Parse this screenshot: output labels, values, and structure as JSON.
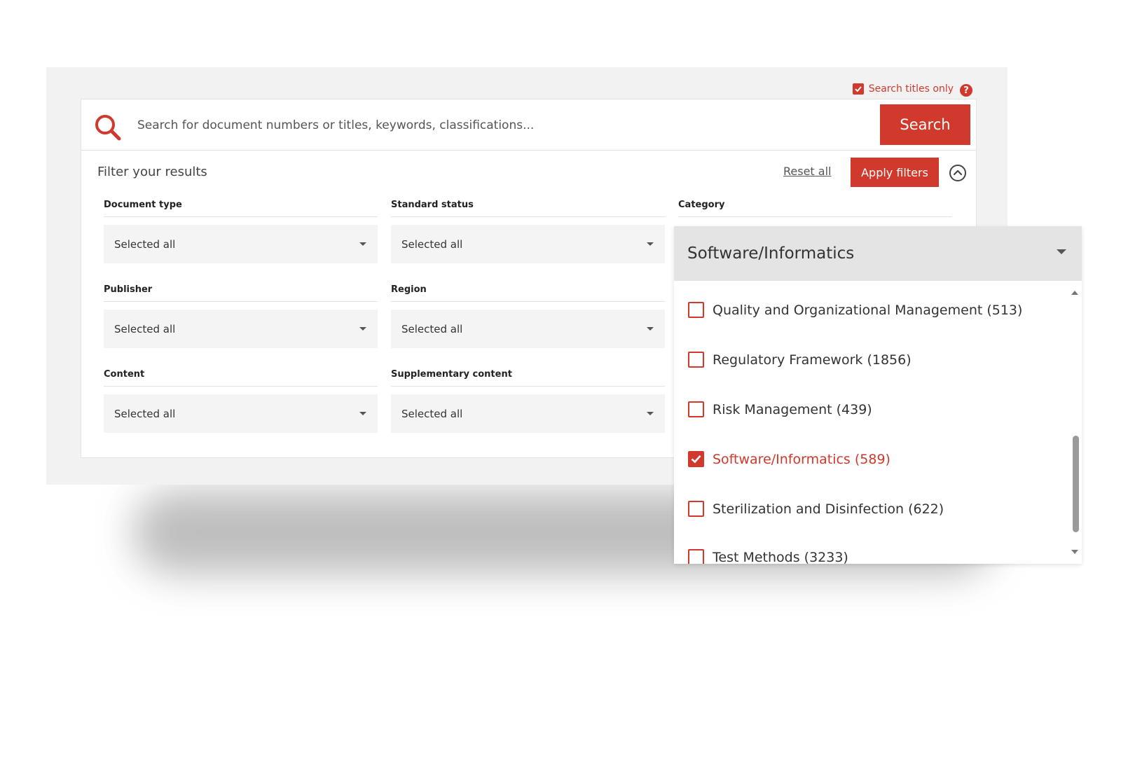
{
  "search": {
    "titles_only_label": "Search titles only",
    "titles_only_checked": true,
    "placeholder": "Search for document numbers or titles, keywords, classifications...",
    "button_label": "Search"
  },
  "filters": {
    "title": "Filter your results",
    "reset_label": "Reset all",
    "apply_label": "Apply filters",
    "groups": [
      {
        "label": "Document type",
        "value": "Selected all"
      },
      {
        "label": "Standard status",
        "value": "Selected all"
      },
      {
        "label": "Category",
        "value": "Software/Informatics"
      },
      {
        "label": "Publisher",
        "value": "Selected all"
      },
      {
        "label": "Region",
        "value": "Selected all"
      },
      {
        "label": "Content",
        "value": "Selected all"
      },
      {
        "label": "Supplementary content",
        "value": "Selected all"
      }
    ]
  },
  "category_dropdown": {
    "selected": "Software/Informatics",
    "options": [
      {
        "label": "Quality and Organizational Management (513)",
        "checked": false
      },
      {
        "label": "Regulatory Framework (1856)",
        "checked": false
      },
      {
        "label": "Risk Management (439)",
        "checked": false
      },
      {
        "label": "Software/Informatics (589)",
        "checked": true
      },
      {
        "label": "Sterilization and Disinfection (622)",
        "checked": false
      },
      {
        "label": "Test Methods (3233)",
        "checked": false
      }
    ]
  },
  "colors": {
    "accent": "#d0392b",
    "panel_bg": "#f2f2f2",
    "select_bg": "#f4f4f4"
  },
  "icons": {
    "search": "search-icon",
    "help": "help-icon",
    "collapse": "chevron-up-circle-icon",
    "caret": "caret-down-icon",
    "check": "checkmark-icon"
  }
}
